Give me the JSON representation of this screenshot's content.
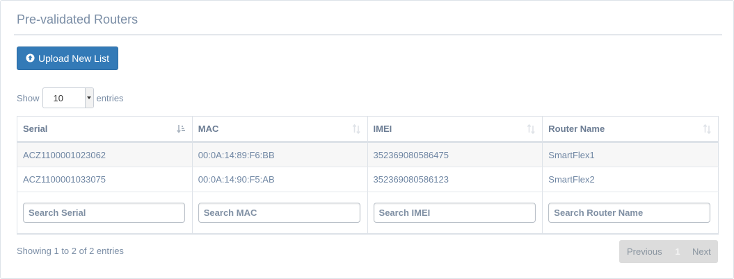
{
  "panel": {
    "title": "Pre-validated Routers"
  },
  "toolbar": {
    "upload_label": "Upload New List"
  },
  "length": {
    "show_label": "Show",
    "value": "10",
    "entries_label": "entries"
  },
  "table": {
    "columns": [
      {
        "label": "Serial",
        "search_placeholder": "Search Serial"
      },
      {
        "label": "MAC",
        "search_placeholder": "Search MAC"
      },
      {
        "label": "IMEI",
        "search_placeholder": "Search IMEI"
      },
      {
        "label": "Router Name",
        "search_placeholder": "Search Router Name"
      }
    ],
    "rows": [
      [
        "ACZ1100001023062",
        "00:0A:14:89:F6:BB",
        "352369080586475",
        "SmartFlex1"
      ],
      [
        "ACZ1100001033075",
        "00:0A:14:90:F5:AB",
        "352369080586123",
        "SmartFlex2"
      ]
    ]
  },
  "info": {
    "text": "Showing 1 to 2 of 2 entries"
  },
  "pagination": {
    "previous": "Previous",
    "current": "1",
    "next": "Next"
  }
}
